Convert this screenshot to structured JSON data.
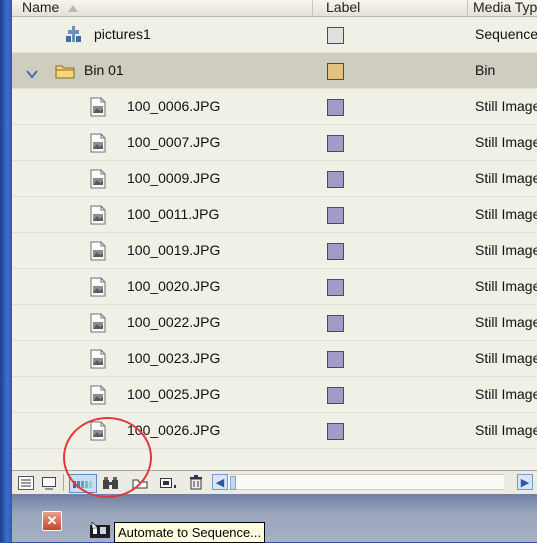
{
  "columns": {
    "name": "Name",
    "label": "Label",
    "media": "Media Type"
  },
  "rows": [
    {
      "name": "pictures1",
      "icon": "sequence-icon",
      "label_color": "#dde0dc",
      "media": "Sequence",
      "indent": 1,
      "bin": false
    },
    {
      "name": "Bin 01",
      "icon": "folder-icon",
      "label_color": "#e3c07c",
      "media": "Bin",
      "indent": 0,
      "bin": true
    },
    {
      "name": "100_0006.JPG",
      "icon": "still-image-icon",
      "label_color": "#a09cc7",
      "media": "Still Image",
      "indent": 2,
      "bin": false
    },
    {
      "name": "100_0007.JPG",
      "icon": "still-image-icon",
      "label_color": "#a09cc7",
      "media": "Still Image",
      "indent": 2,
      "bin": false
    },
    {
      "name": "100_0009.JPG",
      "icon": "still-image-icon",
      "label_color": "#a09cc7",
      "media": "Still Image",
      "indent": 2,
      "bin": false
    },
    {
      "name": "100_0011.JPG",
      "icon": "still-image-icon",
      "label_color": "#a09cc7",
      "media": "Still Image",
      "indent": 2,
      "bin": false
    },
    {
      "name": "100_0019.JPG",
      "icon": "still-image-icon",
      "label_color": "#a09cc7",
      "media": "Still Image",
      "indent": 2,
      "bin": false
    },
    {
      "name": "100_0020.JPG",
      "icon": "still-image-icon",
      "label_color": "#a09cc7",
      "media": "Still Image",
      "indent": 2,
      "bin": false
    },
    {
      "name": "100_0022.JPG",
      "icon": "still-image-icon",
      "label_color": "#a09cc7",
      "media": "Still Image",
      "indent": 2,
      "bin": false
    },
    {
      "name": "100_0023.JPG",
      "icon": "still-image-icon",
      "label_color": "#a09cc7",
      "media": "Still Image",
      "indent": 2,
      "bin": false
    },
    {
      "name": "100_0025.JPG",
      "icon": "still-image-icon",
      "label_color": "#a09cc7",
      "media": "Still Image",
      "indent": 2,
      "bin": false
    },
    {
      "name": "100_0026.JPG",
      "icon": "still-image-icon",
      "label_color": "#a09cc7",
      "media": "Still Image",
      "indent": 2,
      "bin": false
    }
  ],
  "toolbar": {
    "buttons": [
      "list-view-icon",
      "icon-view-icon",
      "automate-to-sequence-icon",
      "find-icon",
      "new-bin-icon",
      "new-item-icon",
      "clear-icon"
    ]
  },
  "tooltip": {
    "text": "Automate to Sequence..."
  },
  "colors": {
    "annotation": "#e0393b",
    "bin_row": "#cfcdc0",
    "panel": "#f0f0e6"
  }
}
